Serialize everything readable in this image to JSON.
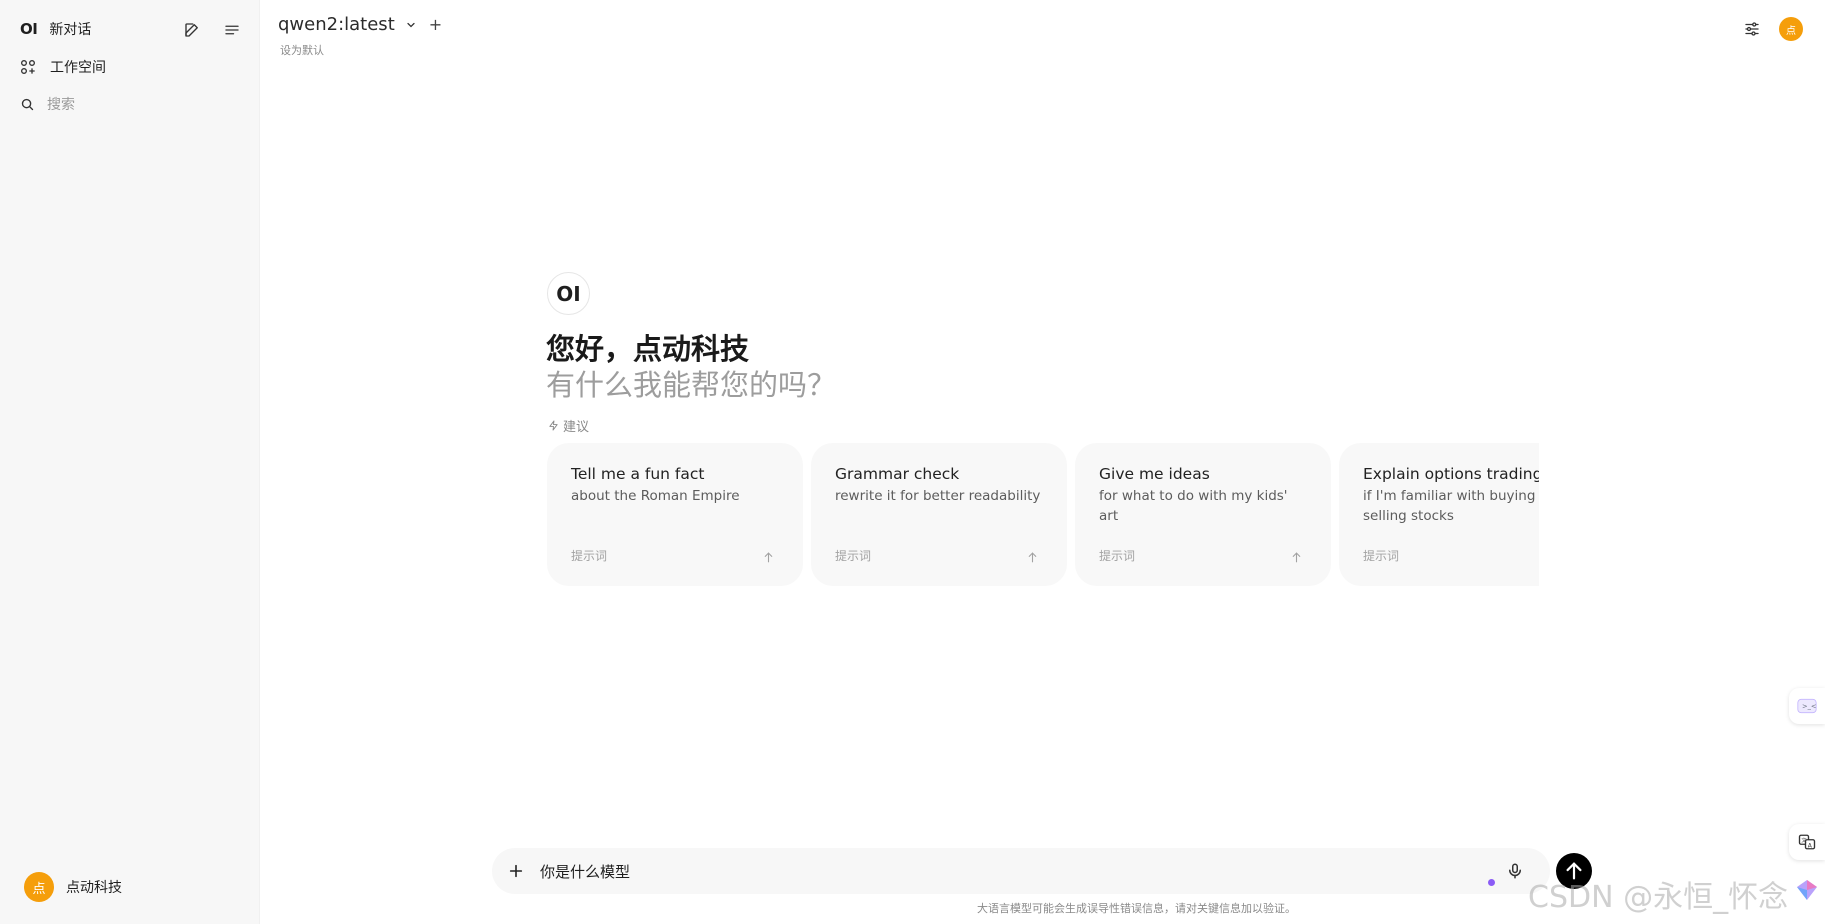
{
  "sidebar": {
    "logo": "OI",
    "new_chat": "新对话",
    "workspace": "工作空间",
    "search_placeholder": "搜索",
    "user": {
      "avatar": "点",
      "name": "点动科技"
    }
  },
  "header": {
    "model_name": "qwen2:latest",
    "add_model": "+",
    "set_default": "设为默认",
    "user_avatar": "点"
  },
  "hero": {
    "logo": "OI",
    "greeting": "您好，点动科技",
    "subgreeting": "有什么我能帮您的吗？"
  },
  "suggestions": {
    "label": "建议",
    "cards": [
      {
        "title": "Tell me a fun fact",
        "subtitle": "about the Roman Empire",
        "prompt_label": "提示词"
      },
      {
        "title": "Grammar check",
        "subtitle": "rewrite it for better readability",
        "prompt_label": "提示词"
      },
      {
        "title": "Give me ideas",
        "subtitle": "for what to do with my kids' art",
        "prompt_label": "提示词"
      },
      {
        "title": "Explain options trading",
        "subtitle": "if I'm familiar with buying and selling stocks",
        "prompt_label": "提示词"
      }
    ]
  },
  "input": {
    "value": "你是什么模型"
  },
  "disclaimer": "大语言模型可能会生成误导性错误信息，请对关键信息加以验证。",
  "watermark": "CSDN @永恒_怀念",
  "colors": {
    "accent": "#f59e0b",
    "send": "#000000",
    "dot": "#8b5cf6"
  }
}
